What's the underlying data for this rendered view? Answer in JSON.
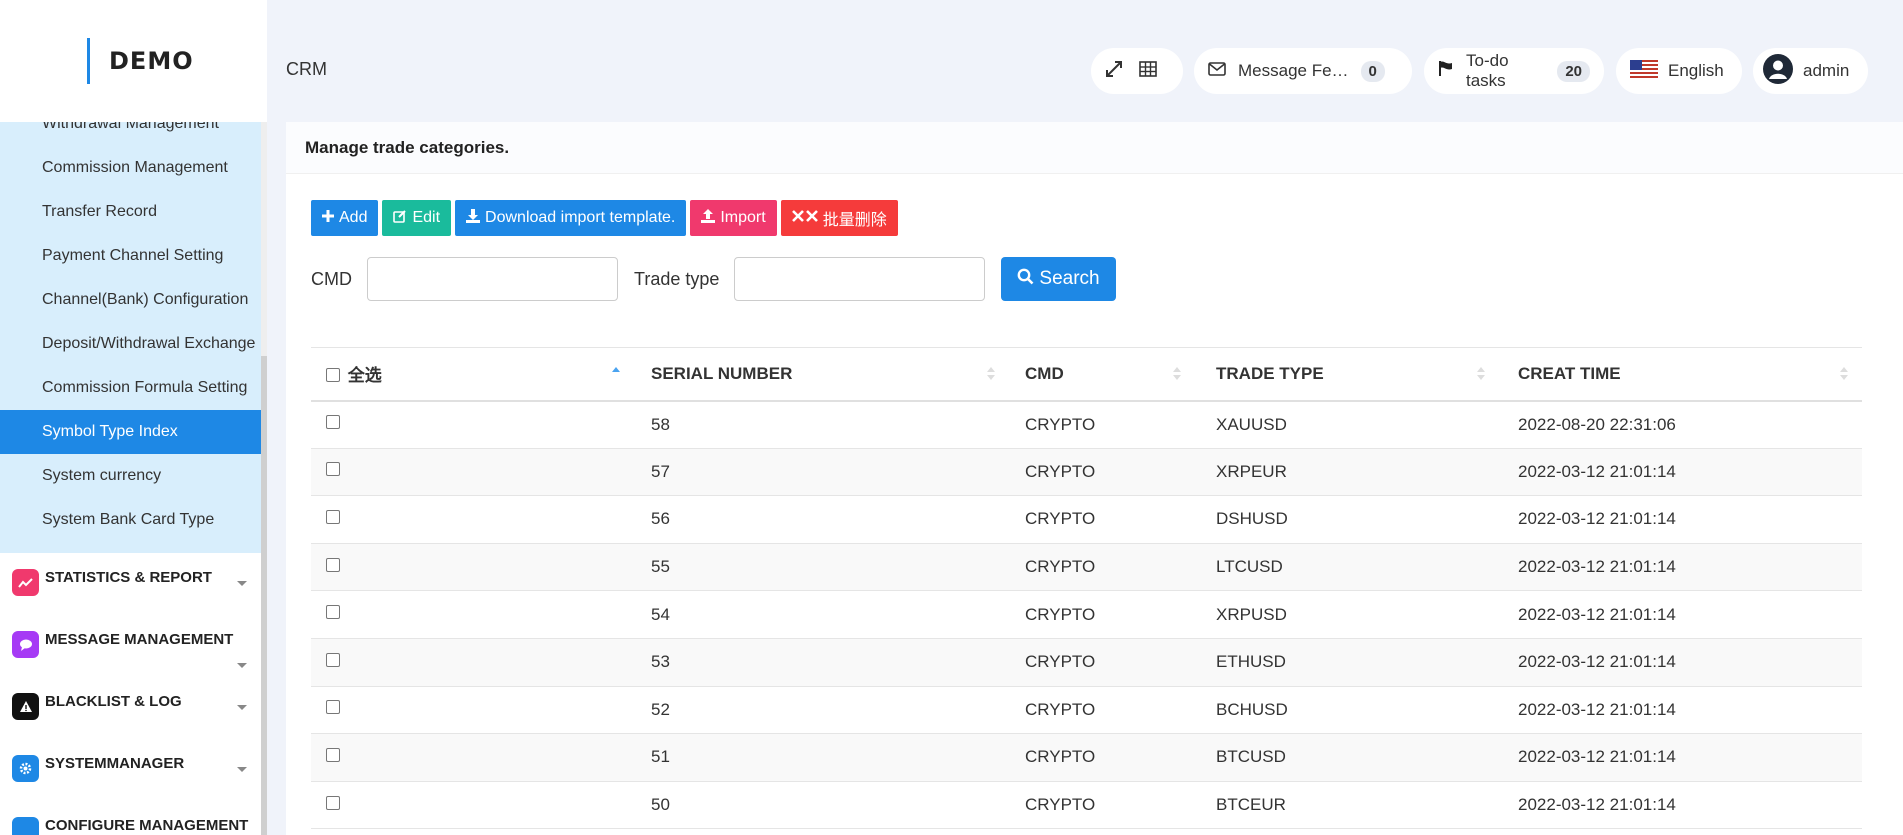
{
  "logo": {
    "text": "DEMO"
  },
  "header": {
    "crm": "CRM",
    "message_label": "Message Fe…",
    "message_count": "0",
    "todo_label": "To-do tasks",
    "todo_count": "20",
    "language": "English",
    "user": "admin"
  },
  "sidebar": {
    "submenu": [
      {
        "label": "Withdrawal Management"
      },
      {
        "label": "Commission Management"
      },
      {
        "label": "Transfer Record"
      },
      {
        "label": "Payment Channel Setting"
      },
      {
        "label": "Channel(Bank) Configuration"
      },
      {
        "label": "Deposit/Withdrawal Exchange"
      },
      {
        "label": "Commission Formula Setting"
      },
      {
        "label": "Symbol Type Index"
      },
      {
        "label": "System currency"
      },
      {
        "label": "System Bank Card Type"
      }
    ],
    "groups": [
      {
        "label": "STATISTICS & REPORT",
        "color": "#f0396d"
      },
      {
        "label": "MESSAGE MANAGEMENT",
        "color": "#a63af5"
      },
      {
        "label": "BLACKLIST & LOG",
        "color": "#111111"
      },
      {
        "label": "SYSTEMMANAGER",
        "color": "#1e88e5"
      },
      {
        "label": "CONFIGURE MANAGEMENT",
        "color": "#1e88e5"
      }
    ]
  },
  "panel": {
    "title": "Manage trade categories.",
    "buttons": {
      "add": "Add",
      "edit": "Edit",
      "download": "Download import template.",
      "import": "Import",
      "batch_delete": "批量删除"
    },
    "search": {
      "cmd_label": "CMD",
      "trade_type_label": "Trade type",
      "search_button": "Search"
    }
  },
  "table": {
    "headers": {
      "select_all": "全选",
      "serial": "SERIAL NUMBER",
      "cmd": "CMD",
      "trade_type": "TRADE TYPE",
      "creat_time": "CREAT TIME"
    },
    "rows": [
      {
        "serial": "58",
        "cmd": "CRYPTO",
        "trade_type": "XAUUSD",
        "time": "2022-08-20 22:31:06"
      },
      {
        "serial": "57",
        "cmd": "CRYPTO",
        "trade_type": "XRPEUR",
        "time": "2022-03-12 21:01:14"
      },
      {
        "serial": "56",
        "cmd": "CRYPTO",
        "trade_type": "DSHUSD",
        "time": "2022-03-12 21:01:14"
      },
      {
        "serial": "55",
        "cmd": "CRYPTO",
        "trade_type": "LTCUSD",
        "time": "2022-03-12 21:01:14"
      },
      {
        "serial": "54",
        "cmd": "CRYPTO",
        "trade_type": "XRPUSD",
        "time": "2022-03-12 21:01:14"
      },
      {
        "serial": "53",
        "cmd": "CRYPTO",
        "trade_type": "ETHUSD",
        "time": "2022-03-12 21:01:14"
      },
      {
        "serial": "52",
        "cmd": "CRYPTO",
        "trade_type": "BCHUSD",
        "time": "2022-03-12 21:01:14"
      },
      {
        "serial": "51",
        "cmd": "CRYPTO",
        "trade_type": "BTCUSD",
        "time": "2022-03-12 21:01:14"
      },
      {
        "serial": "50",
        "cmd": "CRYPTO",
        "trade_type": "BTCEUR",
        "time": "2022-03-12 21:01:14"
      }
    ]
  }
}
